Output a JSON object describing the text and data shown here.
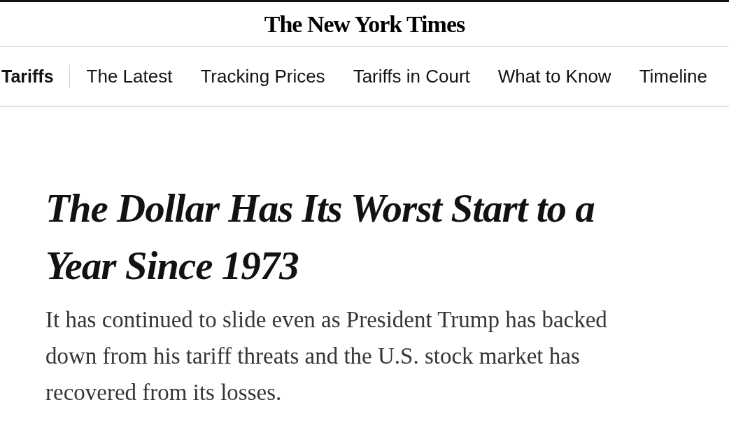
{
  "masthead": {
    "logo": "The New York Times"
  },
  "section_nav": {
    "section": "Tariffs",
    "links": [
      "The Latest",
      "Tracking Prices",
      "Tariffs in Court",
      "What to Know",
      "Timeline"
    ]
  },
  "article": {
    "headline": "The Dollar Has Its Worst Start to a Year Since 1973",
    "summary": "It has continued to slide even as President Trump has backed down from his tariff threats and the U.S. stock market has recovered from its losses."
  }
}
